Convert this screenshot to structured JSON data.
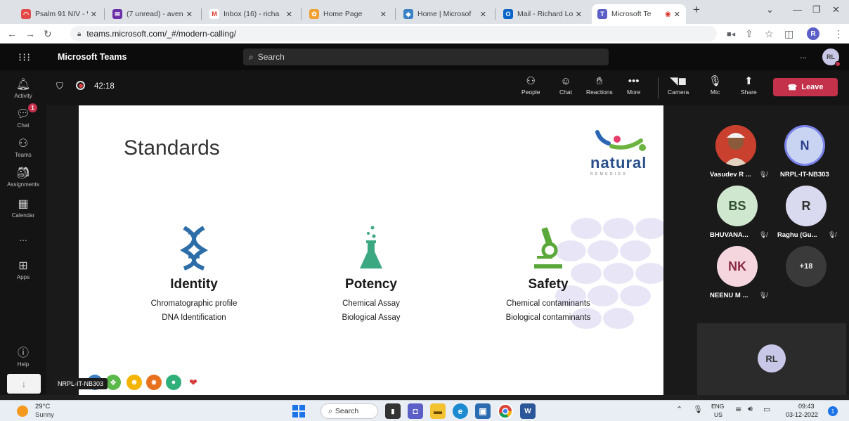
{
  "browser": {
    "tabs": [
      {
        "title": "Psalm 91 NIV - W",
        "icon": "book-icon"
      },
      {
        "title": "(7 unread) - aven",
        "icon": "mail-icon"
      },
      {
        "title": "Inbox (16) - richa",
        "icon": "gmail-icon"
      },
      {
        "title": "Home Page",
        "icon": "flower-icon"
      },
      {
        "title": "Home | Microsof",
        "icon": "microsoft-icon"
      },
      {
        "title": "Mail - Richard Lo",
        "icon": "outlook-icon"
      },
      {
        "title": "Microsoft Te",
        "icon": "teams-icon"
      }
    ],
    "url": "teams.microsoft.com/_#/modern-calling/",
    "profile_initial": "R"
  },
  "teams": {
    "app_title": "Microsoft Teams",
    "search_placeholder": "Search",
    "more_label": "...",
    "user_initials": "RL"
  },
  "rail": {
    "items": [
      {
        "label": "Activity"
      },
      {
        "label": "Chat",
        "badge": "1"
      },
      {
        "label": "Teams"
      },
      {
        "label": "Assignments"
      },
      {
        "label": "Calendar"
      },
      {
        "label": "..."
      },
      {
        "label": "Apps"
      },
      {
        "label": "Help"
      }
    ]
  },
  "meeting": {
    "timer": "42:18",
    "buttons": {
      "people": "People",
      "chat": "Chat",
      "reactions": "Reactions",
      "more": "More",
      "camera": "Camera",
      "mic": "Mic",
      "share": "Share",
      "leave": "Leave"
    },
    "presenter_tag": "NRPL-IT-NB303"
  },
  "slide": {
    "title": "Standards",
    "logo_text": "natural",
    "logo_sub": "R E M E D I E S",
    "pillars": [
      {
        "heading": "Identity",
        "lines": [
          "Chromatographic profile",
          "DNA Identification"
        ]
      },
      {
        "heading": "Potency",
        "lines": [
          "Chemical Assay",
          "Biological Assay"
        ]
      },
      {
        "heading": "Safety",
        "lines": [
          "Chemical contaminants",
          "Biological contaminants"
        ]
      }
    ]
  },
  "participants": [
    {
      "initials": "",
      "name": "Vasudev R ...",
      "color": "#d23a2a"
    },
    {
      "initials": "N",
      "name": "NRPL-IT-NB303",
      "color": "#c9d4f2"
    },
    {
      "initials": "BS",
      "name": "BHUVANA...",
      "color": "#cfe6cf"
    },
    {
      "initials": "R",
      "name": "Raghu (Gu...",
      "color": "#d9d9ef"
    },
    {
      "initials": "NK",
      "name": "NEENU M ...",
      "color": "#f5d6df"
    },
    {
      "initials": "+18",
      "name": "",
      "color": "#3a3a3a"
    }
  ],
  "self": {
    "initials": "RL"
  },
  "taskbar": {
    "weather_temp": "29°C",
    "weather_desc": "Sunny",
    "search_label": "Search",
    "lang_top": "ENG",
    "lang_bottom": "US",
    "time": "09:43",
    "date": "03-12-2022",
    "notification_count": "1"
  }
}
